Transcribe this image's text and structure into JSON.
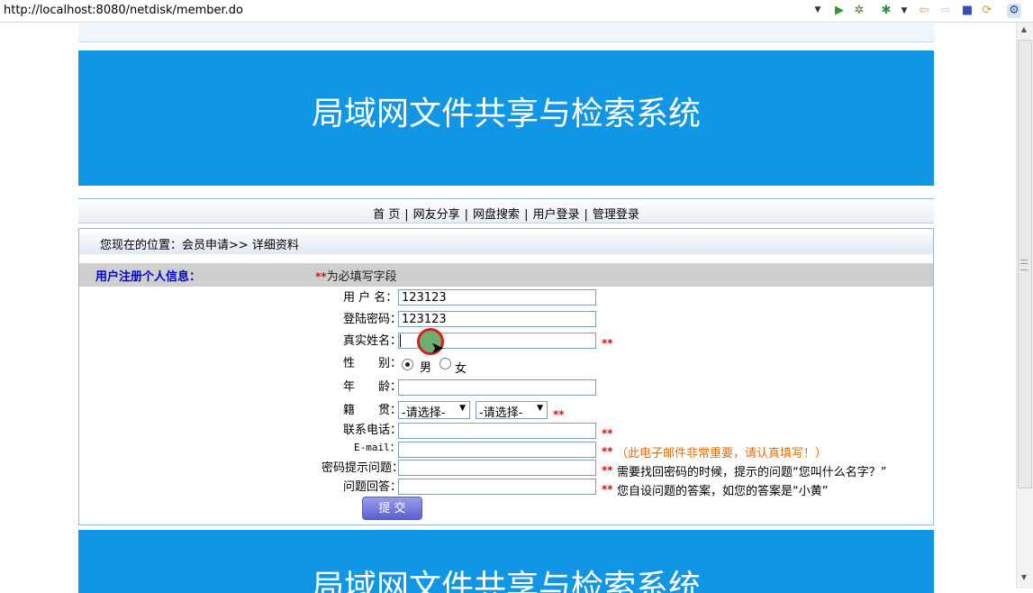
{
  "browser": {
    "url": "http://localhost:8080/netdisk/member.do"
  },
  "banner": {
    "title": "局域网文件共享与检索系统"
  },
  "nav": {
    "items": [
      "首 页",
      "网友分享",
      "网盘搜索",
      "用户登录",
      "管理登录"
    ],
    "separator": "|"
  },
  "breadcrumb": "您现在的位置：会员申请>> 详细资料",
  "form": {
    "heading": "用户注册个人信息：",
    "required_mark": "**",
    "required_note": "为必填写字段",
    "fields": {
      "username": {
        "label": "用 户 名：",
        "value": "123123"
      },
      "password": {
        "label": "登陆密码：",
        "value": "123123"
      },
      "realname": {
        "label": "真实姓名：",
        "value": ""
      },
      "gender": {
        "label": "性　　别：",
        "options": [
          "男",
          "女"
        ],
        "selected": "男"
      },
      "age": {
        "label": "年　　龄：",
        "value": ""
      },
      "native": {
        "label": "籍　　贯：",
        "province": "-请选择-",
        "city": "-请选择-"
      },
      "phone": {
        "label": "联系电话：",
        "value": ""
      },
      "email": {
        "label": "E-mail：",
        "value": "",
        "hint": "（此电子邮件非常重要，请认真填写！）"
      },
      "question": {
        "label": "密码提示问题：",
        "value": "",
        "hint": "需要找回密码的时候，提示的问题“您叫什么名字？”"
      },
      "answer": {
        "label": "问题回答：",
        "value": "",
        "hint": "您自设问题的答案，如您的答案是“小黄”"
      }
    },
    "submit_label": "提 交"
  },
  "footer": {
    "title": "局域网文件共享与检索系统"
  }
}
